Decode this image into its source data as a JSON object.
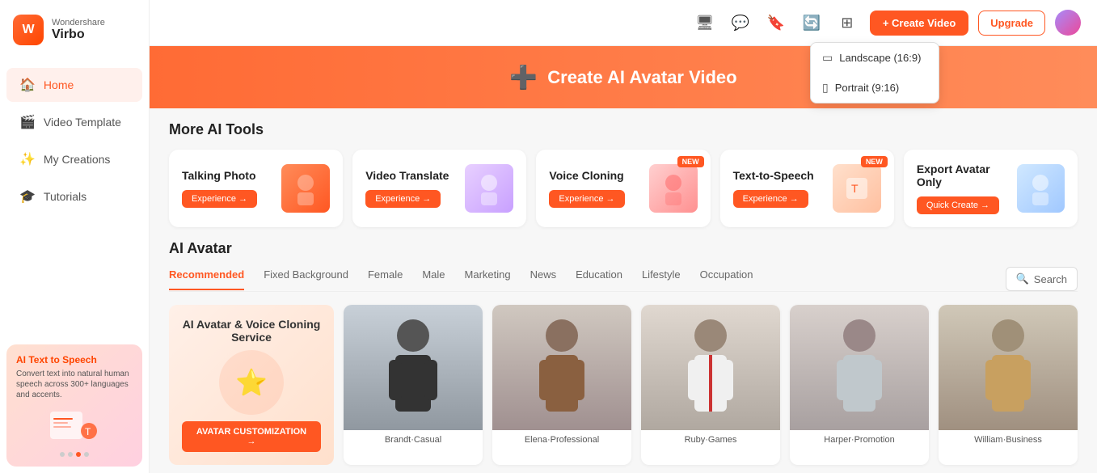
{
  "sidebar": {
    "brand": "Wondershare",
    "app_name": "Virbo",
    "nav_items": [
      {
        "id": "home",
        "label": "Home",
        "icon": "🏠",
        "active": true
      },
      {
        "id": "video-template",
        "label": "Video Template",
        "icon": "🎬",
        "active": false
      },
      {
        "id": "my-creations",
        "label": "My Creations",
        "icon": "✨",
        "active": false
      },
      {
        "id": "tutorials",
        "label": "Tutorials",
        "icon": "🎓",
        "active": false
      }
    ],
    "bottom_card": {
      "title": "AI Text to Speech",
      "desc": "Convert text into natural human speech across 300+ languages and accents."
    }
  },
  "header": {
    "create_button_label": "+ Create Video",
    "upgrade_button_label": "Upgrade",
    "dropdown": {
      "items": [
        {
          "label": "Landscape (16:9)",
          "icon": "▭"
        },
        {
          "label": "Portrait (9:16)",
          "icon": "▯"
        }
      ]
    }
  },
  "hero": {
    "icon": "➕",
    "title": "Create AI Avatar Video"
  },
  "ai_tools": {
    "section_title": "More AI Tools",
    "tools": [
      {
        "id": "talking-photo",
        "name": "Talking Photo",
        "btn_label": "Experience →",
        "new": false,
        "thumb_class": "thumb-talking"
      },
      {
        "id": "video-translate",
        "name": "Video Translate",
        "btn_label": "Experience →",
        "new": false,
        "thumb_class": "thumb-translate"
      },
      {
        "id": "voice-cloning",
        "name": "Voice Cloning",
        "btn_label": "Experience →",
        "new": true,
        "thumb_class": "thumb-voice"
      },
      {
        "id": "text-to-speech",
        "name": "Text-to-Speech",
        "btn_label": "Experience →",
        "new": true,
        "thumb_class": "thumb-tts"
      },
      {
        "id": "export-avatar",
        "name": "Export Avatar Only",
        "btn_label": "Quick Create →",
        "new": false,
        "thumb_class": "thumb-export"
      }
    ],
    "new_badge_label": "NEW"
  },
  "ai_avatar": {
    "section_title": "AI Avatar",
    "filters": [
      {
        "id": "recommended",
        "label": "Recommended",
        "active": true
      },
      {
        "id": "fixed-bg",
        "label": "Fixed Background",
        "active": false
      },
      {
        "id": "female",
        "label": "Female",
        "active": false
      },
      {
        "id": "male",
        "label": "Male",
        "active": false
      },
      {
        "id": "marketing",
        "label": "Marketing",
        "active": false
      },
      {
        "id": "news",
        "label": "News",
        "active": false
      },
      {
        "id": "education",
        "label": "Education",
        "active": false
      },
      {
        "id": "lifestyle",
        "label": "Lifestyle",
        "active": false
      },
      {
        "id": "occupation",
        "label": "Occupation",
        "active": false
      }
    ],
    "search_placeholder": "Search",
    "promo_card": {
      "title": "AI Avatar & Voice Cloning Service",
      "btn_label": "AVATAR CUSTOMIZATION →"
    },
    "avatars": [
      {
        "id": "brandt",
        "label": "Brandt·Casual",
        "color": "#8090a0"
      },
      {
        "id": "elena",
        "label": "Elena·Professional",
        "color": "#90807a"
      },
      {
        "id": "ruby",
        "label": "Ruby·Games",
        "color": "#a09890"
      },
      {
        "id": "harper",
        "label": "Harper·Promotion",
        "color": "#989090"
      },
      {
        "id": "william",
        "label": "William·Business",
        "color": "#a09078"
      }
    ]
  }
}
